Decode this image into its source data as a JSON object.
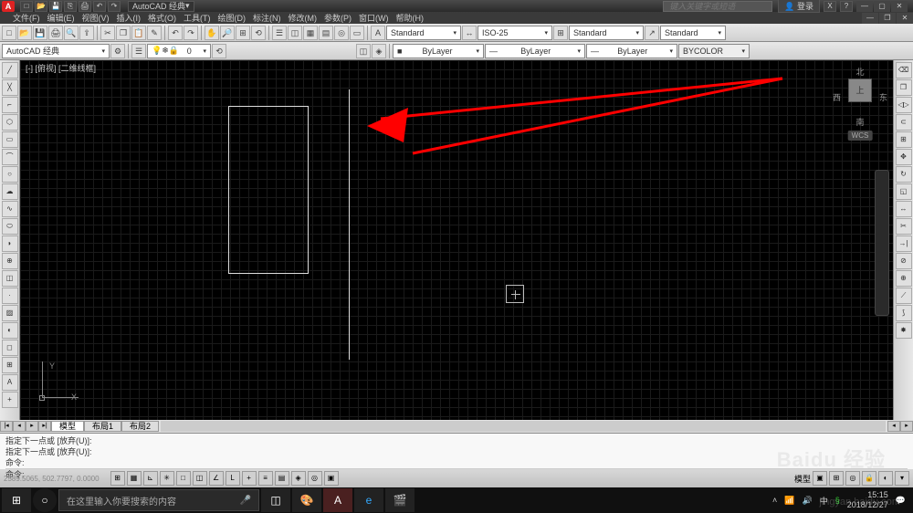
{
  "title": {
    "workspace": "AutoCAD 经典",
    "search_placeholder": "键入关键字或短语",
    "login": "登录"
  },
  "menu": [
    "文件(F)",
    "编辑(E)",
    "视图(V)",
    "插入(I)",
    "格式(O)",
    "工具(T)",
    "绘图(D)",
    "标注(N)",
    "修改(M)",
    "参数(P)",
    "窗口(W)",
    "帮助(H)"
  ],
  "toolbar2": {
    "workspace": "AutoCAD 经典",
    "layer": "0"
  },
  "styles": {
    "text": "Standard",
    "dim": "ISO-25",
    "table": "Standard",
    "mleader": "Standard"
  },
  "props": {
    "color": "ByLayer",
    "ltype": "ByLayer",
    "lweight": "ByLayer",
    "plotstyle": "BYCOLOR"
  },
  "canvas": {
    "view_label": "[-] [俯视] [二维线框]",
    "ucs_x": "X",
    "ucs_y": "Y",
    "cube_top": "上",
    "cube_n": "北",
    "cube_s": "南",
    "cube_w": "西",
    "cube_e": "东",
    "wcs": "WCS"
  },
  "tabs": {
    "model": "模型",
    "layout1": "布局1",
    "layout2": "布局2"
  },
  "cmd": {
    "line1": "指定下一点或 [放弃(U)]:",
    "line2": "指定下一点或 [放弃(U)]:",
    "line3": "命令:",
    "line4": "命令:"
  },
  "status": {
    "coords": "2589.5065, 502.7797, 0.0000",
    "right": "模型"
  },
  "taskbar": {
    "search": "在这里输入你要搜索的内容",
    "time": "15:15",
    "date": "2018/12/27"
  },
  "watermark": {
    "main": "Baidu 经验",
    "sub": "jingyan.baidu.com"
  }
}
